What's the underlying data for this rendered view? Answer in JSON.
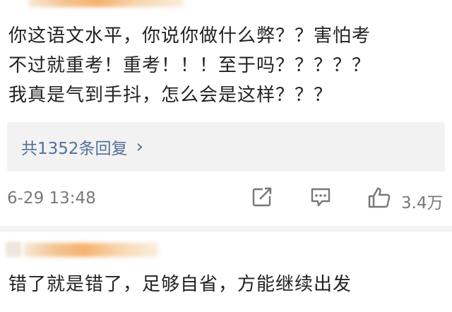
{
  "comment1": {
    "text": "你这语文水平，你说你做什么弊？？害怕考\n不过就重考！重考！！！至于吗？？？？？\n我真是气到手抖，怎么会是这样？？？"
  },
  "reply_box": {
    "label": "共1352条回复"
  },
  "meta": {
    "timestamp": "6-29 13:48",
    "like_count": "3.4万",
    "icons": [
      "share-icon",
      "comment-icon",
      "like-icon"
    ]
  },
  "comment2": {
    "text": "错了就是错了，足够自省，方能继续出发"
  },
  "colors": {
    "link": "#52709a",
    "meta": "#7a7a7a",
    "reply_bg": "#f2f2f2"
  }
}
